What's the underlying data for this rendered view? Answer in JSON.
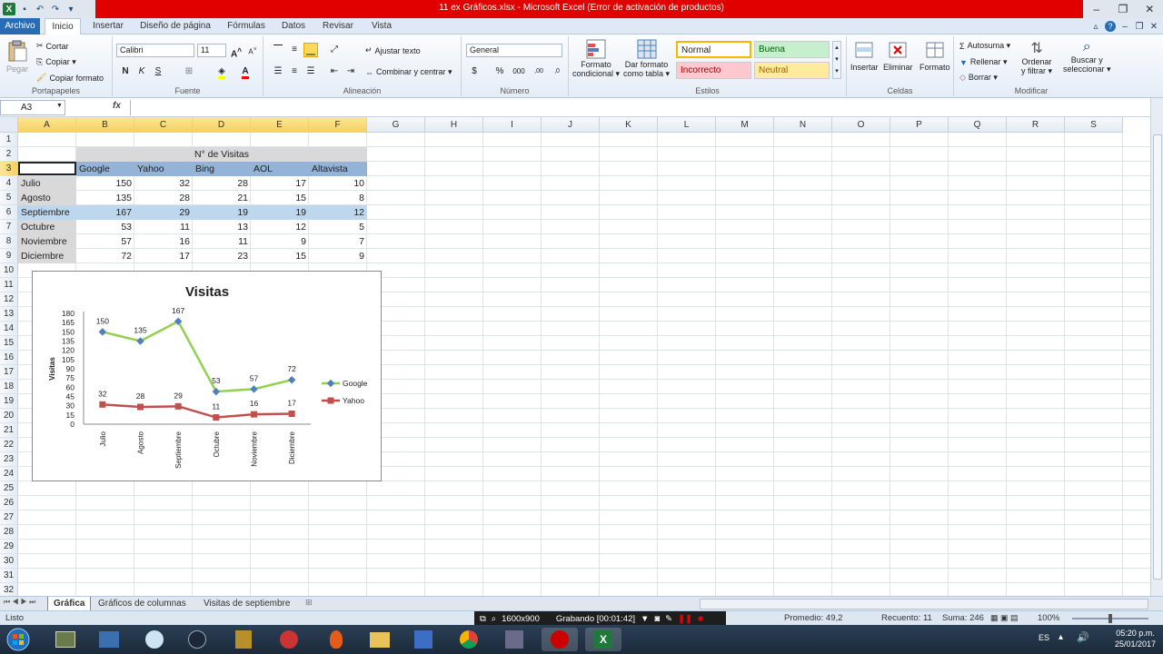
{
  "window": {
    "title": "11 ex Gráficos.xlsx  -  Microsoft Excel (Error de activación de productos)"
  },
  "ribbon": {
    "tabs": [
      "Archivo",
      "Inicio",
      "Insertar",
      "Diseño de página",
      "Fórmulas",
      "Datos",
      "Revisar",
      "Vista"
    ],
    "active_tab": "Inicio",
    "portapapeles": {
      "label": "Portapapeles",
      "pegar": "Pegar",
      "cortar": "Cortar",
      "copiar": "Copiar ▾",
      "copiar_formato": "Copiar formato"
    },
    "fuente": {
      "label": "Fuente",
      "font_name": "Calibri",
      "font_size": "11",
      "bold": "N",
      "italic": "K",
      "underline": "S"
    },
    "alineacion": {
      "label": "Alineación",
      "ajustar_texto": "Ajustar texto",
      "combinar": "Combinar y centrar ▾"
    },
    "numero": {
      "label": "Número",
      "format": "General",
      "currency": "$",
      "percent": "%",
      "thousands": "000",
      "inc_decimal": ",00",
      "dec_decimal": ",0"
    },
    "estilos": {
      "label": "Estilos",
      "formato_condicional": [
        "Formato",
        "condicional ▾"
      ],
      "dar_formato": [
        "Dar formato",
        "como tabla ▾"
      ],
      "normal": "Normal",
      "buena": "Buena",
      "incorrecto": "Incorrecto",
      "neutral": "Neutral",
      "colors": {
        "normal_border": "#f5b800",
        "buena_bg": "#c6efce",
        "buena_fg": "#006100",
        "incorrecto_bg": "#ffc7ce",
        "incorrecto_fg": "#9c0006",
        "neutral_bg": "#ffeb9c",
        "neutral_fg": "#9c6500"
      }
    },
    "celdas": {
      "label": "Celdas",
      "insertar": "Insertar",
      "eliminar": "Eliminar",
      "formato": "Formato"
    },
    "modificar": {
      "label": "Modificar",
      "autosuma": "Autosuma ▾",
      "rellenar": "Rellenar ▾",
      "borrar": "Borrar ▾",
      "ordenar": [
        "Ordenar",
        "y filtrar ▾"
      ],
      "buscar": [
        "Buscar y",
        "seleccionar ▾"
      ]
    }
  },
  "formula_bar": {
    "name_box": "A3",
    "fx": "fx",
    "content": ""
  },
  "columns": [
    "A",
    "B",
    "C",
    "D",
    "E",
    "F",
    "G",
    "H",
    "I",
    "J",
    "K",
    "L",
    "M",
    "N",
    "O",
    "P",
    "Q",
    "R",
    "S"
  ],
  "rows": [
    "1",
    "2",
    "3",
    "4",
    "5",
    "6",
    "7",
    "8",
    "9",
    "10",
    "11",
    "12",
    "13",
    "14",
    "15",
    "16",
    "17",
    "18",
    "19",
    "20",
    "21",
    "22",
    "23",
    "24",
    "25",
    "26",
    "27",
    "28",
    "29",
    "30",
    "31",
    "32"
  ],
  "table": {
    "title": "N° de Visitas",
    "headers": [
      "Google",
      "Yahoo",
      "Bing",
      "AOL",
      "Altavista"
    ],
    "rows": [
      {
        "month": "Julio",
        "values": [
          "150",
          "32",
          "28",
          "17",
          "10"
        ]
      },
      {
        "month": "Agosto",
        "values": [
          "135",
          "28",
          "21",
          "15",
          "8"
        ]
      },
      {
        "month": "Septiembre",
        "values": [
          "167",
          "29",
          "19",
          "19",
          "12"
        ]
      },
      {
        "month": "Octubre",
        "values": [
          "53",
          "11",
          "13",
          "12",
          "5"
        ]
      },
      {
        "month": "Noviembre",
        "values": [
          "57",
          "16",
          "11",
          "9",
          "7"
        ]
      },
      {
        "month": "Diciembre",
        "values": [
          "72",
          "17",
          "23",
          "15",
          "9"
        ]
      }
    ]
  },
  "chart_data": {
    "type": "line",
    "title": "Visitas",
    "xlabel": "",
    "ylabel": "Visitas",
    "categories": [
      "Julio",
      "Agosto",
      "Septiembre",
      "Octubre",
      "Noviembre",
      "Diciembre"
    ],
    "series": [
      {
        "name": "Google",
        "values": [
          150,
          135,
          167,
          53,
          57,
          72
        ],
        "color": "#92d050",
        "marker_color": "#4f81bd"
      },
      {
        "name": "Yahoo",
        "values": [
          32,
          28,
          29,
          11,
          16,
          17
        ],
        "color": "#c0504d",
        "marker_color": "#c0504d"
      }
    ],
    "ylim": [
      0,
      180
    ],
    "yticks": [
      0,
      15,
      30,
      45,
      60,
      75,
      90,
      105,
      120,
      135,
      150,
      165,
      180
    ],
    "legend": "right",
    "grid": false
  },
  "sheets": [
    "Gráfica",
    "Gráficos de columnas",
    "Visitas de septiembre"
  ],
  "active_sheet": "Gráfica",
  "status": {
    "mode": "Listo",
    "resolution": "1600x900",
    "recording": "Grabando [00:01:42]",
    "promedio": "Promedio: 49,2",
    "recuento": "Recuento: 11",
    "suma": "Suma: 246",
    "zoom": "100%"
  },
  "taskbar": {
    "lang": "ES",
    "time": "05:20 p.m.",
    "date": "25/01/2017"
  }
}
